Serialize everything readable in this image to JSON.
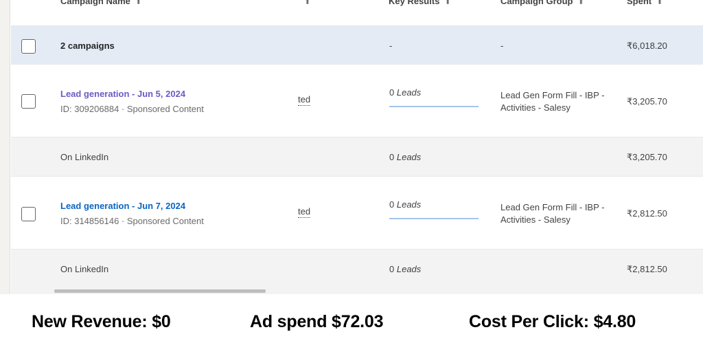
{
  "header": {
    "col_name": "Campaign Name",
    "col_key_results": "Key Results",
    "col_campaign_group": "Campaign Group",
    "col_spent": "Spent",
    "caret": "⬍"
  },
  "summary": {
    "label": "2 campaigns",
    "key_results": "-",
    "campaign_group": "-",
    "spent": "₹6,018.20"
  },
  "campaigns": [
    {
      "name": "Lead generation - Jun 5, 2024",
      "meta": "ID: 309206884 · Sponsored Content",
      "status": "ted",
      "leads_count": "0",
      "leads_unit": "Leads",
      "group": "Lead Gen Form Fill - IBP - Activities - Salesy",
      "spent": "₹3,205.70",
      "sub_label": "On LinkedIn",
      "sub_leads_count": "0",
      "sub_leads_unit": "Leads",
      "sub_spent": "₹3,205.70"
    },
    {
      "name": "Lead generation - Jun 7, 2024",
      "meta": "ID: 314856146 · Sponsored Content",
      "status": "ted",
      "leads_count": "0",
      "leads_unit": "Leads",
      "group": "Lead Gen Form Fill - IBP - Activities - Salesy",
      "spent": "₹2,812.50",
      "sub_label": "On LinkedIn",
      "sub_leads_count": "0",
      "sub_leads_unit": "Leads",
      "sub_spent": "₹2,812.50"
    }
  ],
  "metrics": {
    "revenue": "New Revenue: $0",
    "ad_spend": "Ad spend $72.03",
    "cpc": "Cost Per Click: $4.80"
  },
  "colors": {
    "summary_bg": "#e4ebf4",
    "link": "#0a66c2",
    "link_visited": "#6b5bc4",
    "progress": "#a4c4e9"
  }
}
